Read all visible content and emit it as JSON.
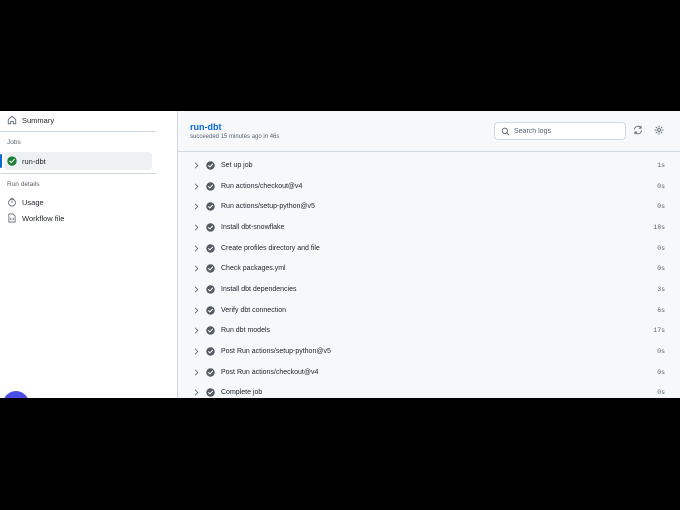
{
  "sidebar": {
    "summary_label": "Summary",
    "jobs_heading": "Jobs",
    "job_item_label": "run-dbt",
    "run_details_heading": "Run details",
    "usage_label": "Usage",
    "workflow_file_label": "Workflow file"
  },
  "header": {
    "job_title": "run-dbt",
    "job_status": "succeeded 15 minutes ago in 46s",
    "search_placeholder": "Search logs"
  },
  "steps": [
    {
      "name": "Set up job",
      "duration": "1s"
    },
    {
      "name": "Run actions/checkout@v4",
      "duration": "0s"
    },
    {
      "name": "Run actions/setup-python@v5",
      "duration": "0s"
    },
    {
      "name": "Install dbt-snowflake",
      "duration": "18s"
    },
    {
      "name": "Create profiles directory and file",
      "duration": "0s"
    },
    {
      "name": "Check packages.yml",
      "duration": "0s"
    },
    {
      "name": "Install dbt dependencies",
      "duration": "3s"
    },
    {
      "name": "Verify dbt connection",
      "duration": "6s"
    },
    {
      "name": "Run dbt models",
      "duration": "17s"
    },
    {
      "name": "Post Run actions/setup-python@v5",
      "duration": "0s"
    },
    {
      "name": "Post Run actions/checkout@v4",
      "duration": "0s"
    },
    {
      "name": "Complete job",
      "duration": "0s"
    }
  ],
  "colors": {
    "accent": "#0969da",
    "success_check": "#555b62",
    "active_job_status": "#1a7f37"
  }
}
